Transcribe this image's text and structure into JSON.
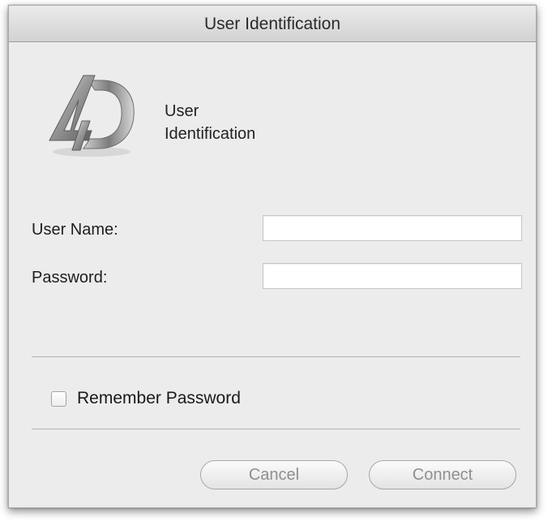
{
  "window": {
    "title": "User Identification"
  },
  "header": {
    "logo_icon": "4d-logo-icon",
    "title_line1": "User",
    "title_line2": "Identification"
  },
  "form": {
    "username_label": "User Name:",
    "username_value": "",
    "password_label": "Password:",
    "password_value": "",
    "remember_label": "Remember Password",
    "remember_checked": false
  },
  "buttons": {
    "cancel_label": "Cancel",
    "connect_label": "Connect",
    "enabled": false
  }
}
